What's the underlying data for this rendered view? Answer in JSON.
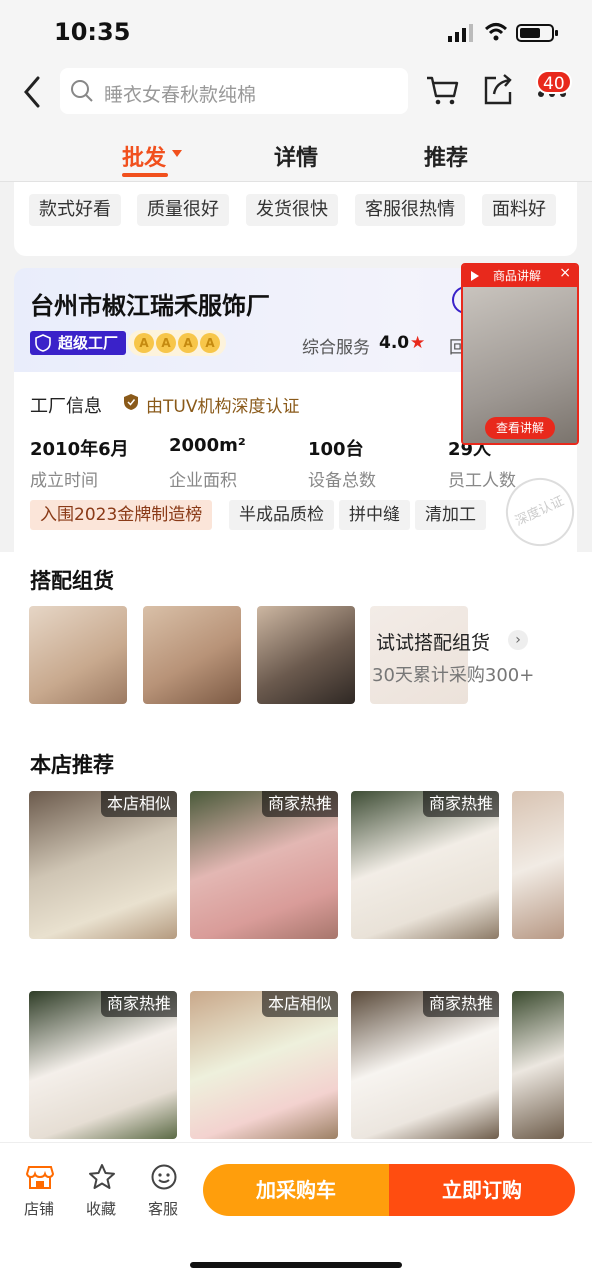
{
  "status_bar": {
    "time": "10:35"
  },
  "header": {
    "search_placeholder": "睡衣女春秋款纯棉",
    "cart_badge": "40"
  },
  "tabs": [
    {
      "label": "批发",
      "active": true
    },
    {
      "label": "详情",
      "active": false
    },
    {
      "label": "推荐",
      "active": false
    }
  ],
  "review_tags": [
    "款式好看",
    "质量很好",
    "发货很快",
    "客服很热情",
    "面料好"
  ],
  "factory": {
    "name": "台州市椒江瑞禾服饰厂",
    "badge": "超级工厂",
    "rating_badge_letter": "A",
    "service_label": "综合服务",
    "service_score": "4.0",
    "service_more": "回",
    "info_label": "工厂信息",
    "cert": "由TUV机构深度认证",
    "stats": [
      {
        "value": "2010年6月",
        "label": "成立时间"
      },
      {
        "value": "2000m²",
        "label": "企业面积"
      },
      {
        "value": "100台",
        "label": "设备总数"
      },
      {
        "value": "29人",
        "label": "员工人数"
      }
    ],
    "highlight_tags": [
      "入围2023金牌制造榜",
      "半成品质检",
      "拼中缝",
      "清加工"
    ],
    "stamp": "深度认证"
  },
  "video": {
    "title": "商品讲解",
    "button": "查看讲解",
    "close": "×"
  },
  "bundle": {
    "title": "搭配组货",
    "try_label": "试试搭配组货",
    "purchase_text": "30天累计采购300+"
  },
  "recommend": {
    "title": "本店推荐",
    "row1": [
      "本店相似",
      "商家热推",
      "商家热推",
      ""
    ],
    "row2": [
      "商家热推",
      "本店相似",
      "商家热推",
      ""
    ]
  },
  "bottom_bar": {
    "shop": "店铺",
    "favorite": "收藏",
    "service": "客服",
    "add_cart": "加采购车",
    "buy_now": "立即订购"
  },
  "colors": {
    "accent": "#f1501d",
    "cart_button": "#ff9e0c",
    "buy_button": "#ff4d10",
    "super_badge": "#3a22c9"
  }
}
